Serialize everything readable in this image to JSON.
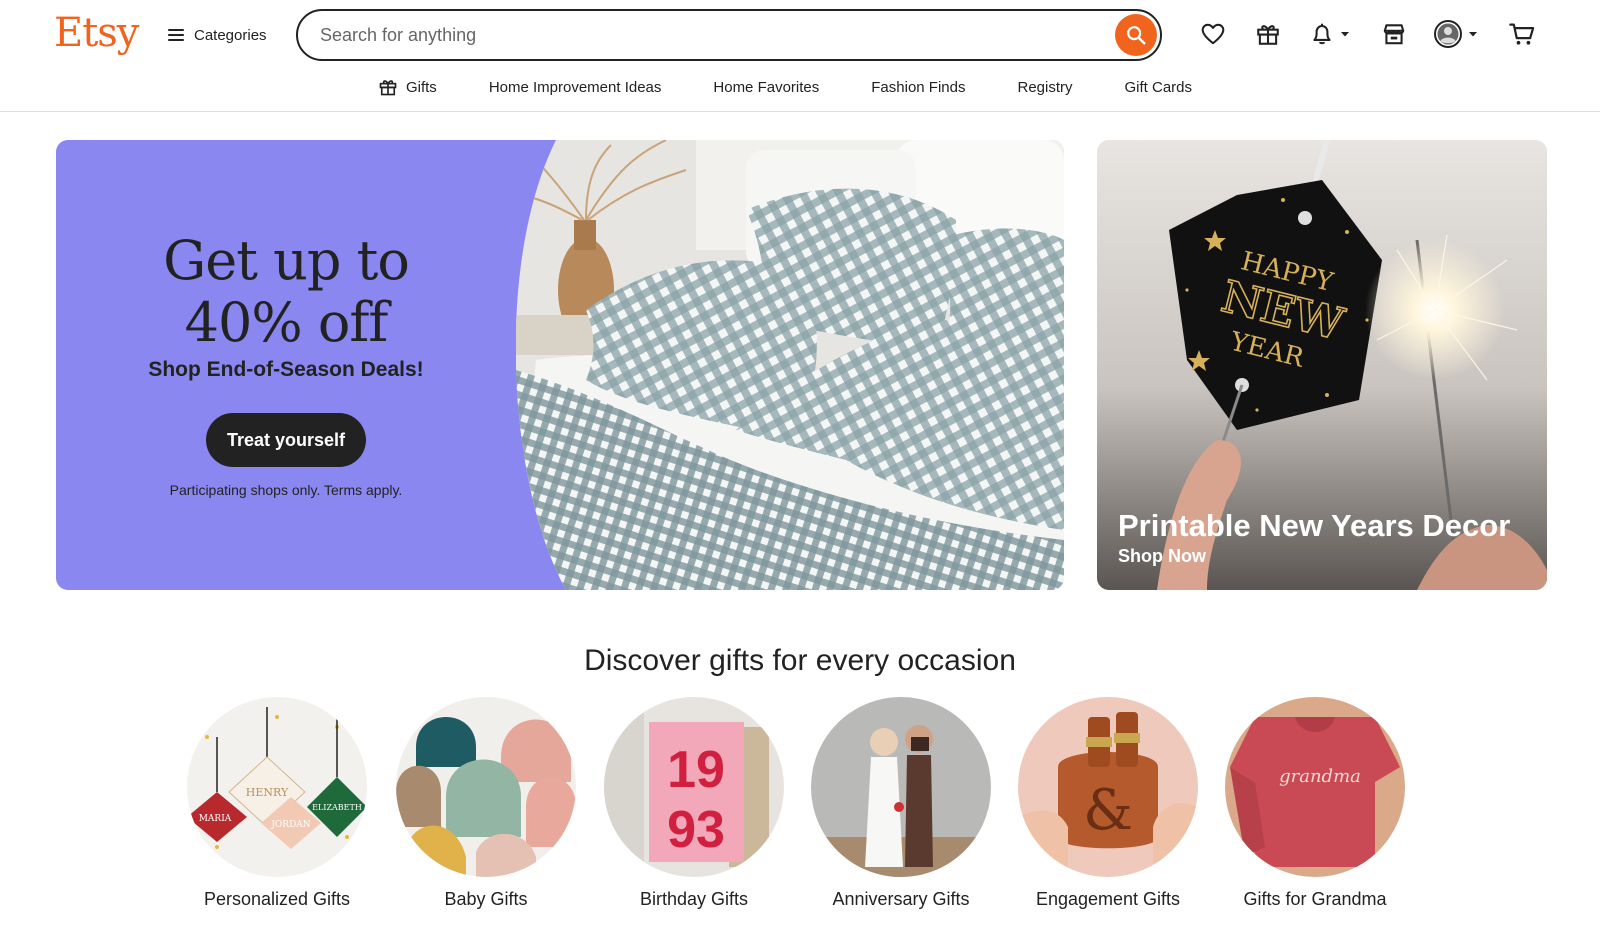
{
  "header": {
    "logo": "Etsy",
    "categories_label": "Categories",
    "search_placeholder": "Search for anything",
    "icons": [
      "heart-icon",
      "gift-icon",
      "bell-icon",
      "shop-icon",
      "avatar-icon",
      "cart-icon"
    ]
  },
  "subnav": {
    "items": [
      {
        "label": "Gifts",
        "icon": "gift-icon"
      },
      {
        "label": "Home Improvement Ideas"
      },
      {
        "label": "Home Favorites"
      },
      {
        "label": "Fashion Finds"
      },
      {
        "label": "Registry"
      },
      {
        "label": "Gift Cards"
      }
    ]
  },
  "hero": {
    "title_line1": "Get up to",
    "title_line2": "40% off",
    "subtitle": "Shop End-of-Season Deals!",
    "cta": "Treat yourself",
    "terms": "Participating shops only. Terms apply.",
    "bg_color": "#8b87f0"
  },
  "promo": {
    "tag_line1": "HAPPY",
    "tag_line2": "NEW",
    "tag_line3": "YEAR",
    "title": "Printable New Years Decor",
    "link": "Shop Now"
  },
  "discover": {
    "title": "Discover gifts for every occasion",
    "items": [
      {
        "label": "Personalized Gifts",
        "names": [
          "HENRY",
          "MARIA",
          "JORDAN",
          "ELIZABETH"
        ]
      },
      {
        "label": "Baby Gifts"
      },
      {
        "label": "Birthday Gifts",
        "poster_top": "19",
        "poster_bottom": "93"
      },
      {
        "label": "Anniversary Gifts"
      },
      {
        "label": "Engagement Gifts"
      },
      {
        "label": "Gifts for Grandma",
        "shirt_text": "grandma"
      }
    ]
  },
  "colors": {
    "accent": "#f1641e",
    "text": "#222222"
  }
}
